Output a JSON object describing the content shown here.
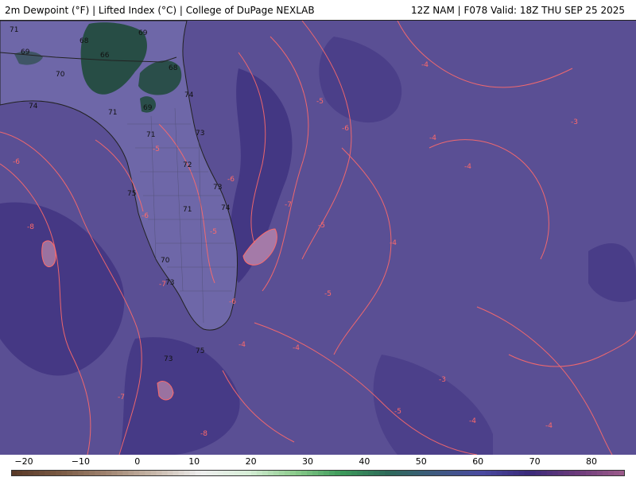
{
  "header": {
    "left_title": "2m Dewpoint (°F) | Lifted Index (°C) | College of DuPage NEXLAB",
    "right_title": "12Z NAM | F078 Valid: 18Z THU SEP 25 2025"
  },
  "colors": {
    "ocean_fill": "#5a4f94",
    "land_fill": "#6e67a8",
    "moist_dark": "#3c2f7e",
    "dry_green": "#1f4a3a",
    "contour": "#ff6a6a",
    "border": "#222222"
  },
  "dewpoint_labels": [
    "71",
    "73",
    "69",
    "68",
    "69",
    "66",
    "70",
    "68",
    "74",
    "74",
    "71",
    "69",
    "71",
    "73",
    "72",
    "73",
    "74",
    "75",
    "71",
    "70",
    "73",
    "75",
    "73"
  ],
  "lifted_index_labels": [
    "-4",
    "-5",
    "-6",
    "-6",
    "-4",
    "-5",
    "-7",
    "-5",
    "-4",
    "-5",
    "-6",
    "-8",
    "-7",
    "-6",
    "-5",
    "-4",
    "-5",
    "-4",
    "-3",
    "-4",
    "-6",
    "-7",
    "-8",
    "-4",
    "-4",
    "-3"
  ],
  "colorbar": {
    "ticks": [
      "−20",
      "−10",
      "0",
      "10",
      "20",
      "30",
      "40",
      "50",
      "60",
      "70",
      "80"
    ]
  }
}
